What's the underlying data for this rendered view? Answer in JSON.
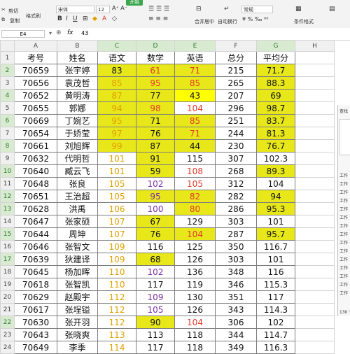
{
  "ribbon": {
    "cut": "剪切",
    "copy": "复制",
    "format_painter": "格式刷",
    "font_name": "宋体",
    "font_size": "12",
    "merge_center": "合并居中",
    "wrap_text": "自动换行",
    "number_format": "常规",
    "conditional_format": "条件格式",
    "top_tab": "开始"
  },
  "formula_bar": {
    "cell_ref": "E4",
    "fx": "fx",
    "value": "43"
  },
  "columns": [
    "A",
    "B",
    "C",
    "D",
    "E",
    "F",
    "G",
    "H"
  ],
  "header": [
    "考号",
    "姓名",
    "语文",
    "数学",
    "英语",
    "总分",
    "平均分"
  ],
  "rows": [
    {
      "n": "2",
      "v": [
        "70659",
        "张宇婷",
        "83",
        "61",
        "71",
        "215",
        "71.7"
      ]
    },
    {
      "n": "3",
      "v": [
        "70656",
        "袁茂哲",
        "85",
        "95",
        "85",
        "265",
        "88.3"
      ]
    },
    {
      "n": "4",
      "v": [
        "70652",
        "黄明涛",
        "87",
        "77",
        "43",
        "207",
        "69"
      ]
    },
    {
      "n": "5",
      "v": [
        "70655",
        "郭娜",
        "94",
        "98",
        "104",
        "296",
        "98.7"
      ]
    },
    {
      "n": "6",
      "v": [
        "70669",
        "丁婉艺",
        "95",
        "71",
        "85",
        "251",
        "83.7"
      ]
    },
    {
      "n": "7",
      "v": [
        "70654",
        "于娇莹",
        "97",
        "76",
        "71",
        "244",
        "81.3"
      ]
    },
    {
      "n": "8",
      "v": [
        "70661",
        "刘旭辉",
        "99",
        "87",
        "44",
        "230",
        "76.7"
      ]
    },
    {
      "n": "9",
      "v": [
        "70632",
        "代明哲",
        "101",
        "91",
        "115",
        "307",
        "102.3"
      ]
    },
    {
      "n": "10",
      "v": [
        "70640",
        "臧云飞",
        "101",
        "59",
        "108",
        "268",
        "89.3"
      ]
    },
    {
      "n": "11",
      "v": [
        "70648",
        "张良",
        "105",
        "102",
        "105",
        "312",
        "104"
      ]
    },
    {
      "n": "12",
      "v": [
        "70651",
        "王治超",
        "105",
        "95",
        "82",
        "282",
        "94"
      ]
    },
    {
      "n": "13",
      "v": [
        "70628",
        "洪禹",
        "106",
        "100",
        "80",
        "286",
        "95.3"
      ]
    },
    {
      "n": "14",
      "v": [
        "70647",
        "张家硕",
        "107",
        "67",
        "129",
        "303",
        "101"
      ]
    },
    {
      "n": "15",
      "v": [
        "70644",
        "周坤",
        "107",
        "76",
        "104",
        "287",
        "95.7"
      ]
    },
    {
      "n": "16",
      "v": [
        "70646",
        "张智文",
        "109",
        "116",
        "125",
        "350",
        "116.7"
      ]
    },
    {
      "n": "17",
      "v": [
        "70639",
        "狄建译",
        "109",
        "68",
        "126",
        "303",
        "101"
      ]
    },
    {
      "n": "18",
      "v": [
        "70645",
        "杨加晖",
        "110",
        "102",
        "136",
        "348",
        "116"
      ]
    },
    {
      "n": "19",
      "v": [
        "70618",
        "张智凯",
        "110",
        "117",
        "119",
        "346",
        "115.3"
      ]
    },
    {
      "n": "20",
      "v": [
        "70629",
        "赵殿宇",
        "112",
        "109",
        "130",
        "351",
        "117"
      ]
    },
    {
      "n": "21",
      "v": [
        "70617",
        "张埕镒",
        "112",
        "105",
        "126",
        "343",
        "114.3"
      ]
    },
    {
      "n": "22",
      "v": [
        "70630",
        "张开羽",
        "112",
        "90",
        "104",
        "306",
        "102"
      ]
    },
    {
      "n": "23",
      "v": [
        "70643",
        "张晓爽",
        "113",
        "113",
        "118",
        "344",
        "114.7"
      ]
    },
    {
      "n": "24",
      "v": [
        "70649",
        "李季",
        "114",
        "117",
        "118",
        "349",
        "116.3"
      ]
    }
  ],
  "panel": {
    "title": "查找",
    "items": [
      "工作",
      "工作",
      "工作",
      "工作",
      "工作",
      "工作",
      "工作",
      "工作",
      "工作",
      "工作",
      "工作",
      "工作",
      "工作",
      "工作",
      "工作"
    ],
    "count": "130 个"
  }
}
